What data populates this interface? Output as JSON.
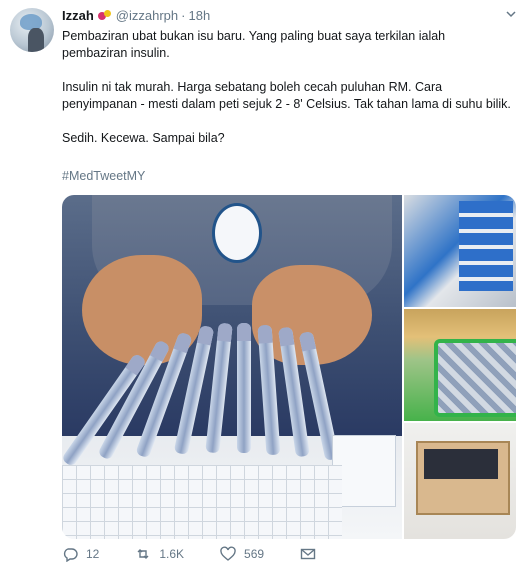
{
  "tweet": {
    "author_name": "Izzah",
    "handle": "@izzahrph",
    "separator": "·",
    "time": "18h",
    "paragraphs": [
      "Pembaziran ubat bukan isu baru. Yang paling buat saya terkilan ialah pembaziran insulin.",
      "Insulin ni tak murah. Harga sebatang boleh cecah puluhan RM. Cara penyimpanan - mesti dalam peti sejuk 2 - 8' Celsius. Tak tahan lama di suhu bilik.",
      "Sedih. Kecewa. Sampai bila?"
    ],
    "hashtag": "#MedTweetMY"
  },
  "actions": {
    "reply": {
      "icon": "reply-icon",
      "count": "12"
    },
    "retweet": {
      "icon": "retweet-icon",
      "count": "1.6K"
    },
    "like": {
      "icon": "heart-icon",
      "count": "569"
    },
    "message": {
      "icon": "mail-icon"
    }
  },
  "colors": {
    "text": "#14171a",
    "secondary": "#657786"
  }
}
